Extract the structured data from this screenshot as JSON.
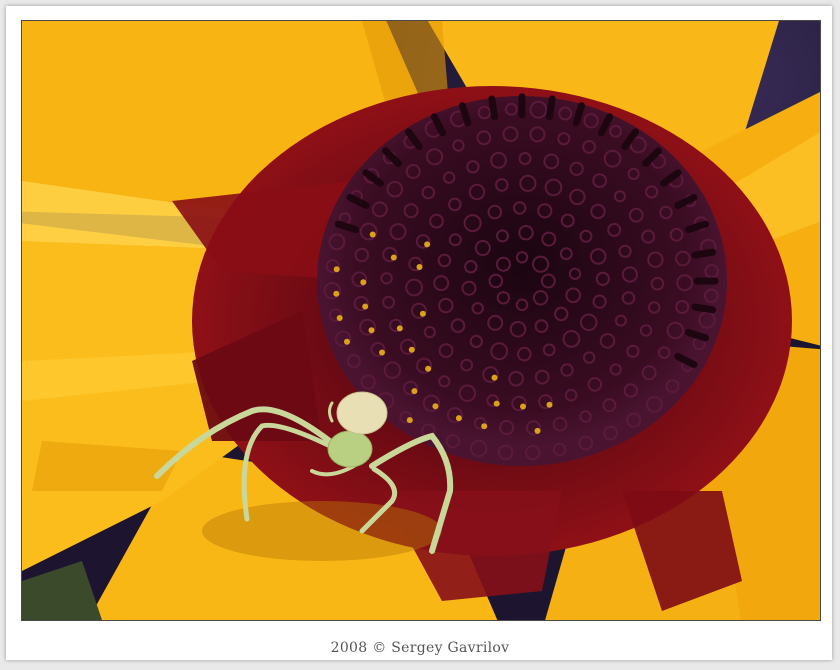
{
  "caption": {
    "text": "2008 © Sergey Gavrilov"
  },
  "palette": {
    "petal": "#f7b413",
    "petal_light": "#ffc928",
    "petal_shadow": "#d88d05",
    "center_red": "#7a0a12",
    "disc_dark": "#2a0a18",
    "floret_purple": "#5a1a3c",
    "pollen": "#d9a21a",
    "spider": "#c9d89a",
    "background": "#2a2140"
  },
  "photo": {
    "subject": "crab-spider-on-flower"
  }
}
